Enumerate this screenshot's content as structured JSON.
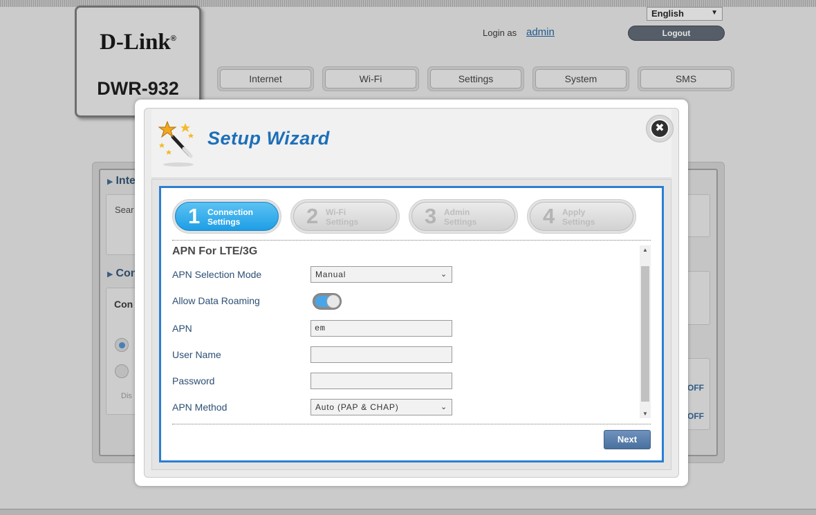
{
  "header": {
    "brand": "D-Link",
    "brand_mark": "®",
    "model": "DWR-932",
    "language": "English",
    "login_label": "Login as",
    "login_user": "admin",
    "logout_label": "Logout"
  },
  "nav": {
    "tabs": [
      "Internet",
      "Wi-Fi",
      "Settings",
      "System",
      "SMS"
    ]
  },
  "background_page": {
    "heading_1": "Inte",
    "text_1": "Sear",
    "heading_2": "Con",
    "subheading": "Con",
    "text_2": "Dis",
    "off_1": "OFF",
    "off_2": "OFF"
  },
  "wizard": {
    "title": "Setup Wizard",
    "close_symbol": "✖",
    "steps": [
      {
        "num": "1",
        "line1": "Connection",
        "line2": "Settings",
        "active": true
      },
      {
        "num": "2",
        "line1": "Wi-Fi",
        "line2": "Settings",
        "active": false
      },
      {
        "num": "3",
        "line1": "Admin",
        "line2": "Settings",
        "active": false
      },
      {
        "num": "4",
        "line1": "Apply",
        "line2": "Settings",
        "active": false
      }
    ],
    "section_title": "APN For LTE/3G",
    "fields": {
      "apn_mode_label": "APN Selection Mode",
      "apn_mode_value": "Manual",
      "roaming_label": "Allow Data Roaming",
      "roaming_on": true,
      "apn_label": "APN",
      "apn_value": "em",
      "username_label": "User Name",
      "username_value": "",
      "password_label": "Password",
      "password_value": "",
      "method_label": "APN Method",
      "method_value": "Auto (PAP & CHAP)"
    },
    "next_label": "Next"
  },
  "colors": {
    "accent_blue": "#2a7ed3",
    "title_blue": "#1d6fb8",
    "step_active": "#1e9ee6",
    "toggle_on": "#48a6e8"
  }
}
